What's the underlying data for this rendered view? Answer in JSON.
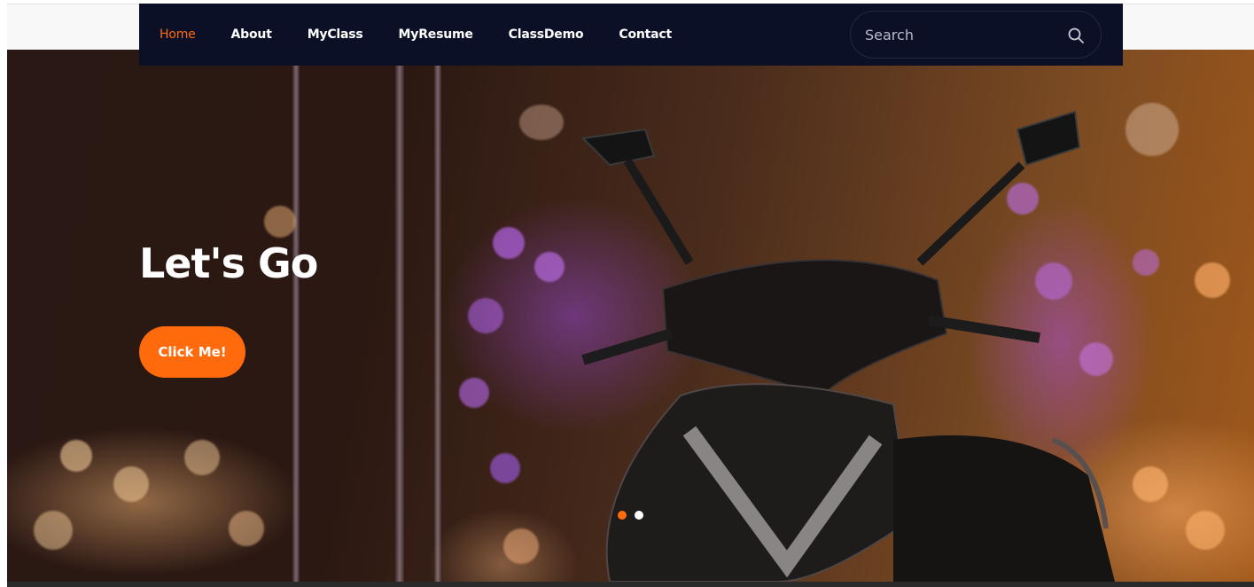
{
  "nav": {
    "items": [
      {
        "label": "Home",
        "active": true
      },
      {
        "label": "About",
        "active": false
      },
      {
        "label": "MyClass",
        "active": false
      },
      {
        "label": "MyResume",
        "active": false
      },
      {
        "label": "ClassDemo",
        "active": false
      },
      {
        "label": "Contact",
        "active": false
      }
    ],
    "search_placeholder": "Search",
    "search_icon": "search-icon"
  },
  "hero": {
    "title": "Let's Go",
    "button_label": "Click Me!",
    "slides": [
      {
        "active": true
      },
      {
        "active": false
      }
    ]
  },
  "colors": {
    "navbar_bg": "#0b1027",
    "accent": "#ff6a0d",
    "text": "#ffffff"
  }
}
